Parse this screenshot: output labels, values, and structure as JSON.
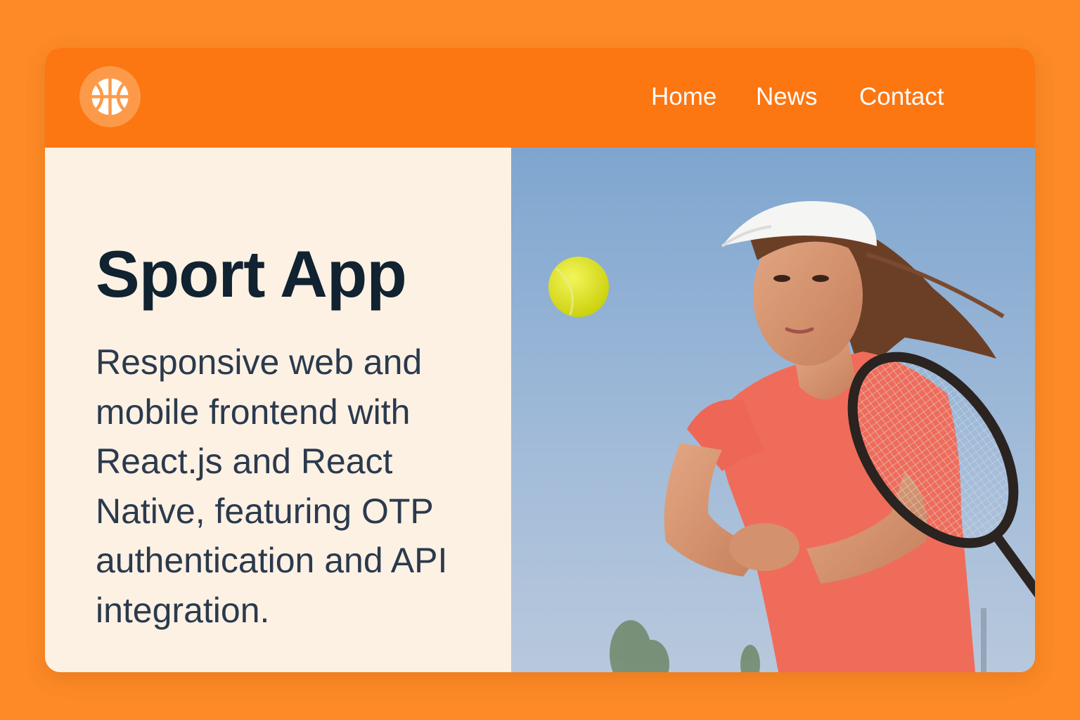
{
  "header": {
    "logo_icon": "basketball-icon",
    "nav": [
      {
        "label": "Home"
      },
      {
        "label": "News"
      },
      {
        "label": "Contact"
      }
    ]
  },
  "hero": {
    "title": "Sport App",
    "description": "Responsive web and mobile frontend with React.js and React Native, featuring OTP authentication and API integration."
  },
  "colors": {
    "page_background": "#FD8A26",
    "header_background": "#FC7612",
    "panel_background": "#FDF1E4",
    "title_color": "#112231",
    "text_color": "#2B3A4D"
  }
}
